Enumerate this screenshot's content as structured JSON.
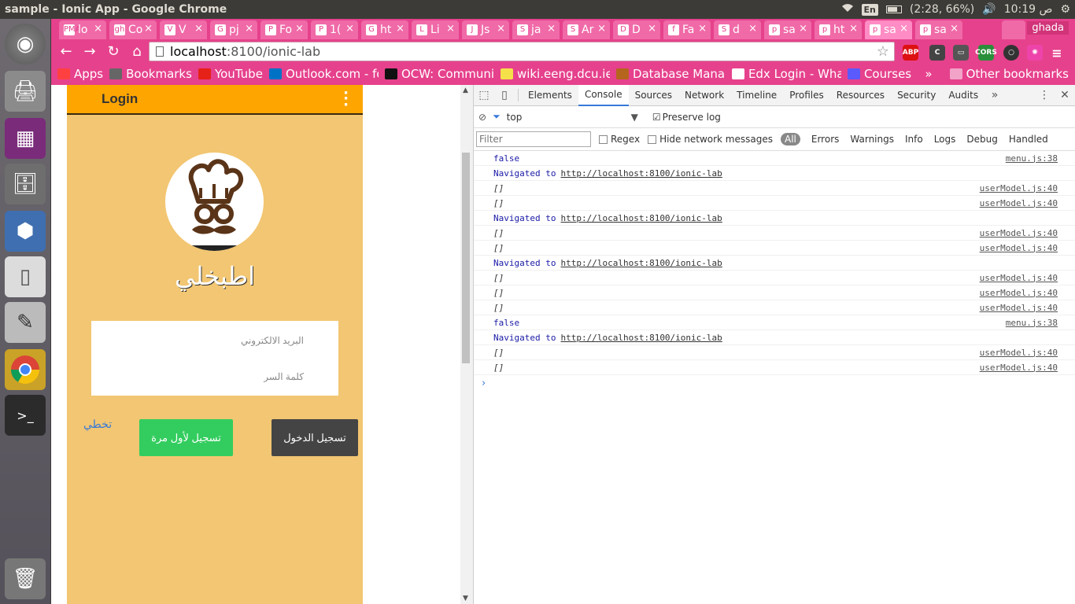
{
  "system": {
    "window_title": "sample - Ionic App - Google Chrome",
    "lang": "En",
    "battery": "(2:28, 66%)",
    "clock": "10:19 ص"
  },
  "tabs": [
    {
      "label": "lo",
      "fav": "PMA"
    },
    {
      "label": "Co",
      "fav": "gh"
    },
    {
      "label": "V",
      "fav": "V"
    },
    {
      "label": "pj",
      "fav": "G"
    },
    {
      "label": "Fo",
      "fav": "P"
    },
    {
      "label": "1(",
      "fav": "P"
    },
    {
      "label": "ht",
      "fav": "G"
    },
    {
      "label": "Li",
      "fav": "L"
    },
    {
      "label": "Js",
      "fav": "J"
    },
    {
      "label": "ja",
      "fav": "S"
    },
    {
      "label": "Ar",
      "fav": "S"
    },
    {
      "label": "D",
      "fav": "D"
    },
    {
      "label": "Fa",
      "fav": "f"
    },
    {
      "label": "d",
      "fav": "S"
    },
    {
      "label": "sa",
      "fav": "p"
    },
    {
      "label": "ht",
      "fav": "p"
    },
    {
      "label": "sa",
      "fav": "p"
    },
    {
      "label": "sa",
      "fav": "p"
    }
  ],
  "profile_name": "ghada",
  "omnibox": {
    "host": "localhost",
    "path": ":8100/ionic-lab"
  },
  "bookmarks": [
    {
      "label": "Apps",
      "color": "#ff4040"
    },
    {
      "label": "Bookmarks",
      "color": "#666666"
    },
    {
      "label": "YouTube",
      "color": "#e62117"
    },
    {
      "label": "Outlook.com - fo",
      "color": "#0072c6"
    },
    {
      "label": "OCW: Communic",
      "color": "#111111"
    },
    {
      "label": "wiki.eeng.dcu.ie/",
      "color": "#f5e04a"
    },
    {
      "label": "Database Manag",
      "color": "#b5651d"
    },
    {
      "label": "Edx Login - What",
      "color": "#ffffff"
    },
    {
      "label": "Courses",
      "color": "#5a5aff"
    }
  ],
  "other_bookmarks": "Other bookmarks",
  "app": {
    "header_title": "Login",
    "brand": "اطبخلي",
    "email_placeholder": "البريد الالكتروني",
    "password_placeholder": "كلمة السر",
    "skip": "تخطي",
    "signup_button": "تسجيل لأول مرة",
    "login_button": "تسجيل الدخول"
  },
  "devtools": {
    "tabs": [
      "Elements",
      "Console",
      "Sources",
      "Network",
      "Timeline",
      "Profiles",
      "Resources",
      "Security",
      "Audits"
    ],
    "context": "top",
    "preserve_log": "Preserve log",
    "filter_placeholder": "Filter",
    "regex": "Regex",
    "hide_network": "Hide network messages",
    "levels": [
      "All",
      "Errors",
      "Warnings",
      "Info",
      "Logs",
      "Debug",
      "Handled"
    ],
    "rows": [
      {
        "type": "log",
        "msg": "false",
        "src": "menu.js:38"
      },
      {
        "type": "nav",
        "msg": "Navigated to",
        "url": "http://localhost:8100/ionic-lab"
      },
      {
        "type": "obj",
        "msg": "[]",
        "src": "userModel.js:40"
      },
      {
        "type": "obj",
        "msg": "[]",
        "src": "userModel.js:40"
      },
      {
        "type": "nav",
        "msg": "Navigated to",
        "url": "http://localhost:8100/ionic-lab"
      },
      {
        "type": "obj",
        "msg": "[]",
        "src": "userModel.js:40"
      },
      {
        "type": "obj",
        "msg": "[]",
        "src": "userModel.js:40"
      },
      {
        "type": "nav",
        "msg": "Navigated to",
        "url": "http://localhost:8100/ionic-lab"
      },
      {
        "type": "obj",
        "msg": "[]",
        "src": "userModel.js:40"
      },
      {
        "type": "obj",
        "msg": "[]",
        "src": "userModel.js:40"
      },
      {
        "type": "obj",
        "msg": "[]",
        "src": "userModel.js:40"
      },
      {
        "type": "log",
        "msg": "false",
        "src": "menu.js:38"
      },
      {
        "type": "nav",
        "msg": "Navigated to",
        "url": "http://localhost:8100/ionic-lab"
      },
      {
        "type": "obj",
        "msg": "[]",
        "src": "userModel.js:40"
      },
      {
        "type": "obj",
        "msg": "[]",
        "src": "userModel.js:40"
      }
    ]
  }
}
